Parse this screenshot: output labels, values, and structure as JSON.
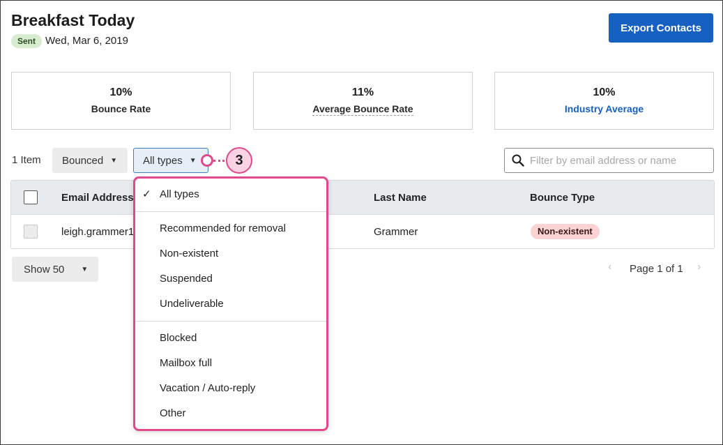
{
  "header": {
    "title": "Breakfast Today",
    "status_badge": "Sent",
    "date": "Wed, Mar 6, 2019",
    "export_label": "Export Contacts"
  },
  "stats": [
    {
      "value": "10%",
      "label": "Bounce Rate"
    },
    {
      "value": "11%",
      "label": "Average Bounce Rate"
    },
    {
      "value": "10%",
      "label": "Industry Average"
    }
  ],
  "toolbar": {
    "item_count": "1 Item",
    "bounced_filter": "Bounced",
    "type_filter": "All types",
    "search_placeholder": "Filter by email address or name"
  },
  "callout": {
    "number": "3"
  },
  "table": {
    "columns": [
      "Email Address",
      "Last Name",
      "Bounce Type"
    ],
    "rows": [
      {
        "email": "leigh.grammer1",
        "last_name": "Grammer",
        "bounce_type": "Non-existent"
      }
    ]
  },
  "footer": {
    "show_label": "Show 50",
    "page_text": "Page 1 of 1"
  },
  "dropdown": {
    "selected": "All types",
    "items": [
      "All types",
      "Recommended for removal",
      "Non-existent",
      "Suspended",
      "Undeliverable",
      "Blocked",
      "Mailbox full",
      "Vacation / Auto-reply",
      "Other"
    ]
  },
  "colors": {
    "accent": "#1660c2",
    "callout": "#e0498b",
    "badge_sent_bg": "#d8ecd0",
    "badge_bounce_bg": "#fbd3d3"
  },
  "icons": {
    "search": "search-icon",
    "chevron": "chevron-down-icon",
    "check": "check-icon",
    "prev": "chevron-left-icon",
    "next": "chevron-right-icon"
  }
}
